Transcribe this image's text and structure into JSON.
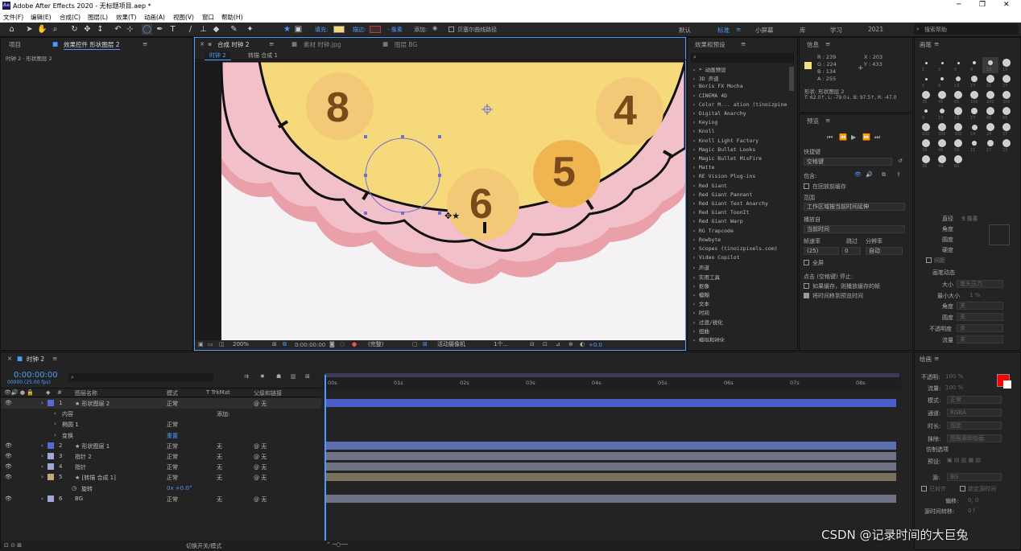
{
  "app_title": "Adobe After Effects 2020 - 无标题项目.aep *",
  "menu": [
    "文件(F)",
    "编辑(E)",
    "合成(C)",
    "图层(L)",
    "效果(T)",
    "动画(A)",
    "视图(V)",
    "窗口",
    "帮助(H)"
  ],
  "toolbar": {
    "fill_label": "填充:",
    "stroke_label": "描边:",
    "stroke_value": "- 像素",
    "add_label": "添加:",
    "bezier_label": "贝塞尔曲线路径",
    "workspaces": [
      "默认",
      "标准",
      "小屏幕",
      "库",
      "学习",
      "2021"
    ],
    "search_placeholder": "搜索帮助",
    "fill_color": "#f6d97a",
    "accent_color": "#4d9bff"
  },
  "project_panel": {
    "tab_project": "项目",
    "tab_effects": "效果控件 形状图层 2",
    "breadcrumb": "时钟 2 · 形状图层 2"
  },
  "comp_panel": {
    "tab_comp": "合成 时钟 2",
    "tab_footage": "素材 时钟.jpg",
    "tab_layer": "图层 BG",
    "subtab_active": "时钟 2",
    "subtab_other": "转描 合成 1",
    "clock_numbers": [
      "8",
      "4",
      "5",
      "6"
    ],
    "zoom": "200%",
    "timecode": "0:00:00:00",
    "resolution": "(完整)",
    "camera": "活动摄像机",
    "views": "1个...",
    "exposure": "+0.0"
  },
  "effects_panel": {
    "title": "效果和预设",
    "items": [
      "* 动画预设",
      "3D 声道",
      "Boris FX Mocha",
      "CINEMA 4D",
      "Color M... ation (tinoizpine)",
      "Digital Anarchy",
      "Keying",
      "Knoll",
      "Knoll Light Factory",
      "Magic Bullet Looks",
      "Magic Bullet MisFire",
      "Matte",
      "RE Vision Plug-ins",
      "Red Giant",
      "Red Giant Pannant",
      "Red Giant Text Anarchy",
      "Red Giant ToonIt",
      "Red Giant Warp",
      "RG Trapcode",
      "Rowbyte",
      "Scopes (tinoizpixels.com)",
      "Video Copilot",
      "声道",
      "实用工具",
      "抠像",
      "模糊",
      "文本",
      "时间",
      "过渡/锐化",
      "扭曲",
      "模拟和锐化"
    ]
  },
  "info_panel": {
    "title": "信息",
    "rgba": [
      "R : 239",
      "G : 224",
      "B : 134",
      "A : 255"
    ],
    "xy": [
      "X : 203",
      "Y : 433"
    ],
    "shape_line": "形状: 形状图层 2",
    "coords_line": "T: 62.0↑, L: -79.0↓, B: 97.5↑, R: -47.0",
    "swatch_color": "#efe086"
  },
  "preview_panel": {
    "title": "预览",
    "shortcut_label": "快捷键",
    "shortcut_value": "空格键",
    "include_label": "包含:",
    "cache_label": "在回放前缓存",
    "range_label": "范围",
    "range_value": "工作区域按当前时间延伸",
    "play_from_label": "播放自",
    "play_from_value": "当前时间",
    "fps_label": "帧速率",
    "skip_label": "跳过",
    "res_label": "分辨率",
    "fps_value": "(25)",
    "skip_value": "0",
    "res_value": "自动",
    "fullscreen_label": "全屏",
    "stop_label": "点击 (空格键) 停止:",
    "cache_opt": "如果缓存，则播放缓存的帧",
    "move_opt": "将时间移到预览时间"
  },
  "brush_panel": {
    "title": "画笔",
    "sizes": [
      "1",
      "3",
      "5",
      "9",
      "13",
      "19",
      "5",
      "9",
      "13",
      "17",
      "21",
      "27",
      "35",
      "45",
      "65",
      "100",
      "200",
      "300",
      "9",
      "13",
      "19",
      "17",
      "45",
      "65",
      "100",
      "200",
      "300",
      "14",
      "24",
      "27",
      "39",
      "46",
      "59",
      "11",
      "17",
      "23",
      "36",
      "44",
      "60"
    ],
    "diameter_label": "直径",
    "diameter_value": "9 像素",
    "angle_label": "角度",
    "roundness_label": "圆度",
    "hardness_label": "硬度",
    "spacing_label": "间距",
    "dynamics_label": "画笔动态",
    "size_label": "大小",
    "size_value": "笔头压力",
    "min_size_label": "最小大小",
    "min_size_value": "1 %",
    "angle2_label": "角度",
    "roundness2_label": "圆度",
    "opacity_label": "不透明度",
    "flow_label": "流量",
    "off_value": "关"
  },
  "paint_panel": {
    "title": "绘画",
    "opacity_label": "不透明:",
    "opacity_value": "100 %",
    "flow_label": "流量:",
    "flow_value": "100 %",
    "mode_label": "模式:",
    "mode_value": "正常",
    "channel_label": "通道:",
    "channel_value": "RGBA",
    "duration_label": "时长:",
    "duration_value": "固定",
    "erase_label": "抹除:",
    "erase_value": "图层源和绘画",
    "clone_label": "仿制选项",
    "preset_label": "预设:",
    "source_label": "源:",
    "source_value": "BG",
    "aligned_label": "已对齐",
    "lock_label": "锁定源时间",
    "offset_label": "偏移:",
    "offset_value": "0, 0",
    "source_time_label": "源时间转移:",
    "source_time_value": "0 f",
    "fg_color": "#ff0000",
    "bg_color": "#ffffff"
  },
  "timeline": {
    "tab": "时钟 2",
    "timecode": "0:00:00:00",
    "fps": "00000 (25.00 fps)",
    "col_name": "图层名称",
    "col_mode": "模式",
    "col_trkmat": "T TrkMat",
    "col_parent": "父级和链接",
    "ruler": [
      "00s",
      "01s",
      "02s",
      "03s",
      "04s",
      "05s",
      "06s",
      "07s",
      "08s"
    ],
    "layers": [
      {
        "num": "1",
        "name": "形状图层 2",
        "mode": "正常",
        "trk": "",
        "parent": "无",
        "color": "#5a6ad4",
        "bar": "#4a5fc7"
      },
      {
        "num": "",
        "name": "内容",
        "mode": "",
        "trk": "添加:",
        "parent": "",
        "color": "",
        "bar": ""
      },
      {
        "num": "",
        "name": "椭圆 1",
        "mode": "正常",
        "trk": "",
        "parent": "",
        "color": "",
        "bar": ""
      },
      {
        "num": "",
        "name": "变换",
        "mode": "重置",
        "trk": "",
        "parent": "",
        "color": "",
        "bar": ""
      },
      {
        "num": "2",
        "name": "形状图层 1",
        "mode": "正常",
        "trk": "无",
        "parent": "无",
        "color": "#5a6ad4",
        "bar": "#5a6db0"
      },
      {
        "num": "3",
        "name": "指针 2",
        "mode": "正常",
        "trk": "无",
        "parent": "无",
        "color": "#a0a8d8",
        "bar": "#6f7385"
      },
      {
        "num": "4",
        "name": "指针",
        "mode": "正常",
        "trk": "无",
        "parent": "无",
        "color": "#a0a8d8",
        "bar": "#6f7385"
      },
      {
        "num": "5",
        "name": "[转描 合成 1]",
        "mode": "正常",
        "trk": "无",
        "parent": "无",
        "color": "#c4a878",
        "bar": "#7a7060"
      },
      {
        "num": "",
        "name": "旋转",
        "mode": "0x +0.0°",
        "trk": "",
        "parent": "",
        "color": "",
        "bar": ""
      },
      {
        "num": "6",
        "name": "BG",
        "mode": "正常",
        "trk": "无",
        "parent": "无",
        "color": "#a0a8d8",
        "bar": "#6f7385"
      }
    ],
    "footer_label": "切换开关/模式"
  },
  "watermark": "CSDN @记录时间的大巨兔"
}
